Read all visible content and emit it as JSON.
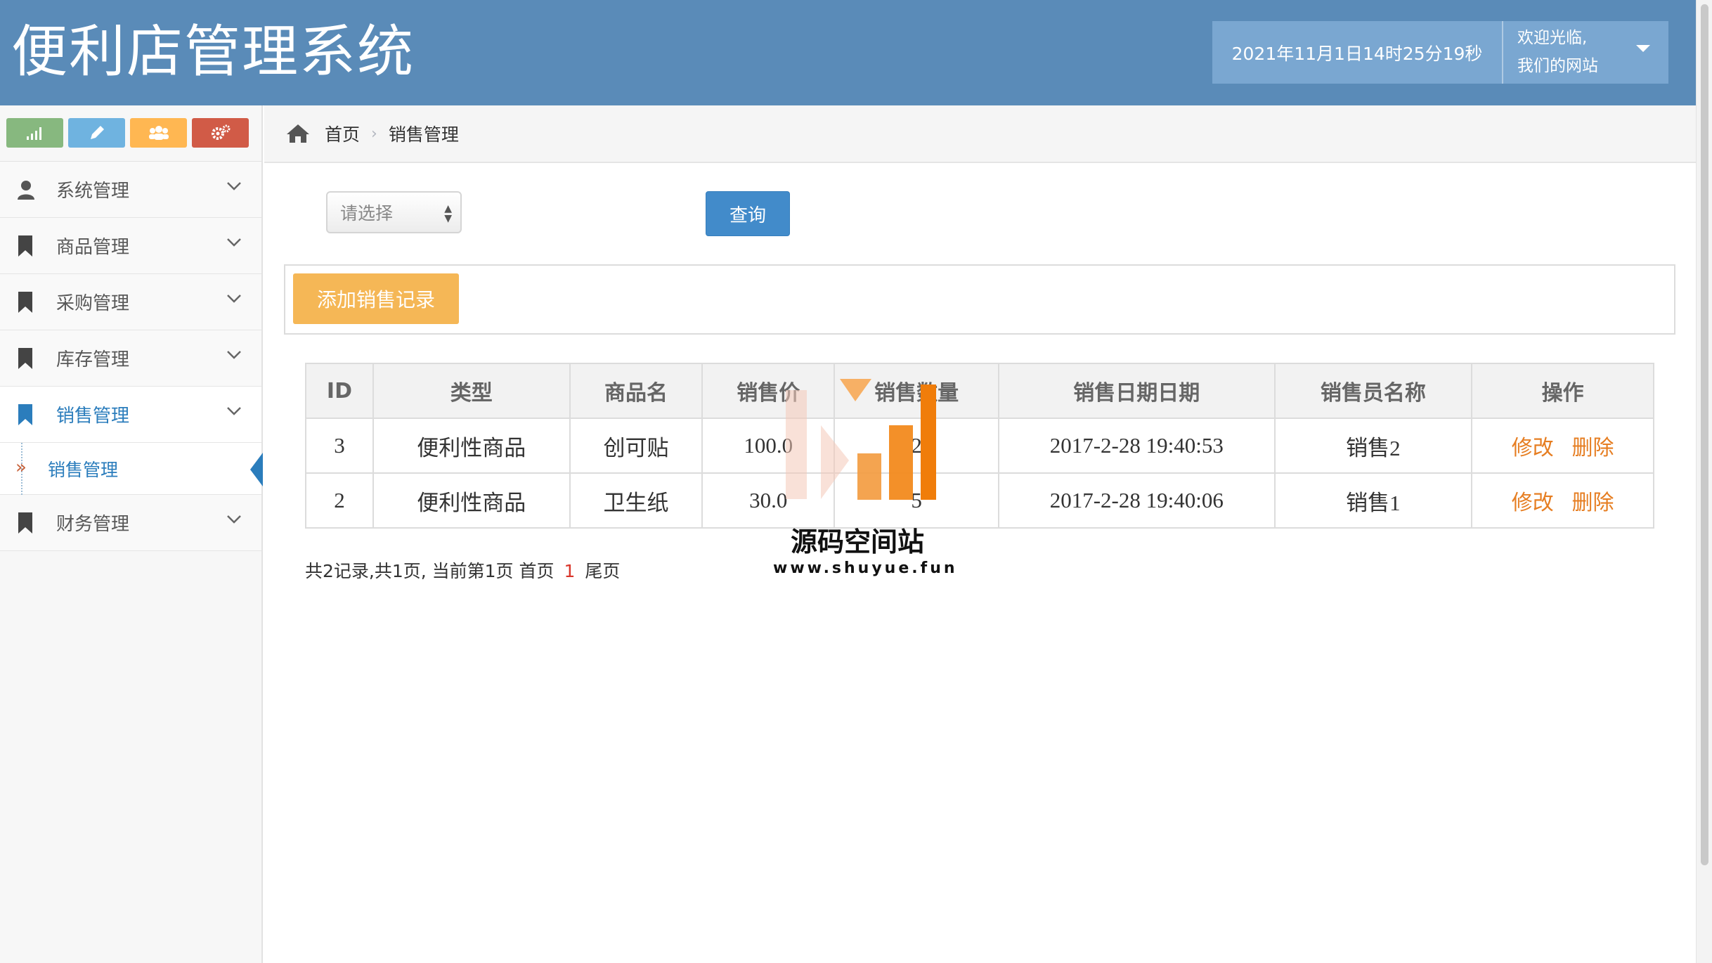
{
  "header": {
    "title": "便利店管理系统",
    "datetime": "2021年11月1日14时25分19秒",
    "welcome_line1": "欢迎光临,",
    "welcome_line2": "我们的网站"
  },
  "sidebar": {
    "shortcuts": [
      "signal-icon",
      "pencil-icon",
      "users-icon",
      "cogs-icon"
    ],
    "items": [
      {
        "label": "系统管理",
        "icon": "user-icon"
      },
      {
        "label": "商品管理",
        "icon": "bookmark-icon"
      },
      {
        "label": "采购管理",
        "icon": "bookmark-icon"
      },
      {
        "label": "库存管理",
        "icon": "bookmark-icon"
      },
      {
        "label": "销售管理",
        "icon": "bookmark-icon",
        "active": true
      },
      {
        "label": "财务管理",
        "icon": "bookmark-icon"
      }
    ],
    "sub_item": "销售管理"
  },
  "breadcrumb": {
    "home": "首页",
    "current": "销售管理"
  },
  "query": {
    "select_value": "请选择",
    "button": "查询"
  },
  "toolbar": {
    "add_label": "添加销售记录"
  },
  "table": {
    "headers": [
      "ID",
      "类型",
      "商品名",
      "销售价",
      "销售数量",
      "销售日期日期",
      "销售员名称",
      "操作"
    ],
    "rows": [
      {
        "id": "3",
        "type": "便利性商品",
        "name": "创可贴",
        "price": "100.0",
        "qty": "2",
        "date": "2017-2-28 19:40:53",
        "seller": "销售2",
        "edit": "修改",
        "delete": "删除"
      },
      {
        "id": "2",
        "type": "便利性商品",
        "name": "卫生纸",
        "price": "30.0",
        "qty": "5",
        "date": "2017-2-28 19:40:06",
        "seller": "销售1",
        "edit": "修改",
        "delete": "删除"
      }
    ]
  },
  "pager": {
    "summary": "共2记录,共1页, 当前第1页 首页",
    "current": "1",
    "last": "尾页"
  },
  "watermark": {
    "name": "源码空间站",
    "url": "www.shuyue.fun"
  },
  "colors": {
    "header_bg": "#5a8bb8",
    "accent_blue": "#2b7dbc",
    "add_button": "#f5b756",
    "op_link": "#e67e22"
  }
}
